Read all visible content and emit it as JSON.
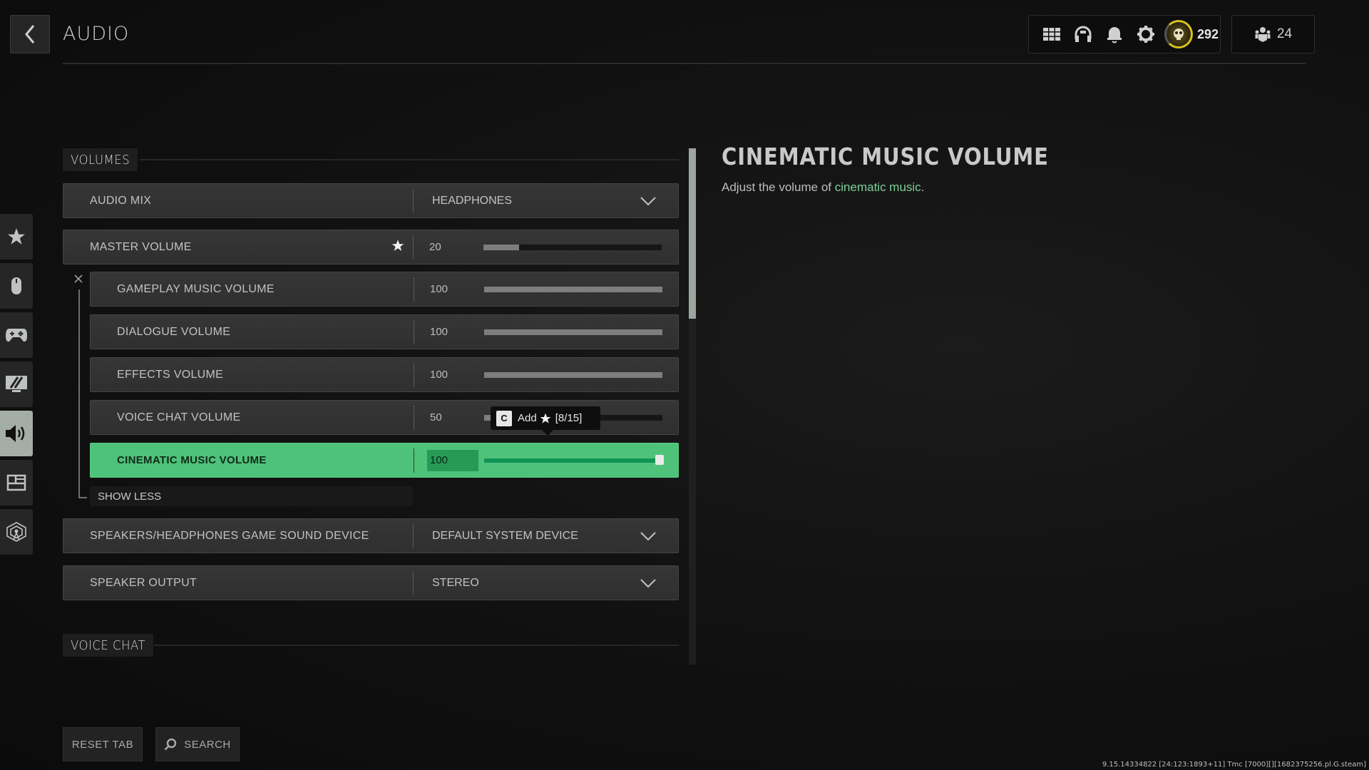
{
  "header": {
    "title": "AUDIO",
    "back_icon": "chevron-left-icon"
  },
  "hud": {
    "icons": [
      "grid-menu-icon",
      "headphones-icon",
      "bell-icon",
      "gear-icon",
      "player-emblem-icon"
    ],
    "level": "292",
    "friends_count": "24",
    "friends_icon": "friends-icon",
    "emblem_ring_color": "#d8c21f"
  },
  "sidebar": {
    "items": [
      {
        "name": "favorites",
        "icon": "star-icon",
        "active": false
      },
      {
        "name": "mouse-keyboard",
        "icon": "mouse-icon",
        "active": false
      },
      {
        "name": "controller",
        "icon": "gamepad-icon",
        "active": false
      },
      {
        "name": "graphics",
        "icon": "monitor-icon",
        "active": false
      },
      {
        "name": "audio",
        "icon": "speaker-icon",
        "active": true
      },
      {
        "name": "interface",
        "icon": "layout-icon",
        "active": false
      },
      {
        "name": "network",
        "icon": "antenna-icon",
        "active": false
      }
    ]
  },
  "sections": {
    "volumes": {
      "title": "VOLUMES",
      "audio_mix": {
        "label": "AUDIO MIX",
        "value": "HEADPHONES"
      },
      "master_volume": {
        "label": "MASTER VOLUME",
        "value": "20",
        "level": 20,
        "favorited": true
      },
      "sub_volumes": [
        {
          "label": "GAMEPLAY MUSIC VOLUME",
          "value": "100",
          "level": 100
        },
        {
          "label": "DIALOGUE VOLUME",
          "value": "100",
          "level": 100
        },
        {
          "label": "EFFECTS VOLUME",
          "value": "100",
          "level": 100
        },
        {
          "label": "VOICE CHAT VOLUME",
          "value": "50",
          "level": 50
        },
        {
          "label": "CINEMATIC MUSIC VOLUME",
          "value": "100",
          "level": 100,
          "selected": true
        }
      ],
      "show_less_label": "SHOW LESS",
      "sound_device": {
        "label": "SPEAKERS/HEADPHONES GAME SOUND DEVICE",
        "value": "DEFAULT SYSTEM DEVICE"
      },
      "speaker_output": {
        "label": "SPEAKER OUTPUT",
        "value": "STEREO"
      }
    },
    "voice_chat": {
      "title": "VOICE CHAT"
    }
  },
  "tooltip": {
    "key": "C",
    "text": "Add",
    "count": "[8/15]"
  },
  "detail": {
    "title": "CINEMATIC MUSIC VOLUME",
    "desc_prefix": "Adjust the volume of ",
    "desc_highlight": "cinematic music",
    "desc_suffix": ".",
    "highlight_color": "#7fd19a"
  },
  "scroll": {
    "visible_fraction": 0.33,
    "position": 0
  },
  "footer": {
    "reset_label": "RESET TAB",
    "search_label": "SEARCH",
    "build_info": "9.15.14334822 [24:123:1893+11] Tmc [7000][][1682375256.pl.G.steam]"
  },
  "colors": {
    "accent_green": "#4fc27a",
    "slider_fill": "#7d7f7c",
    "sidebar_active": "#a5ada7"
  }
}
